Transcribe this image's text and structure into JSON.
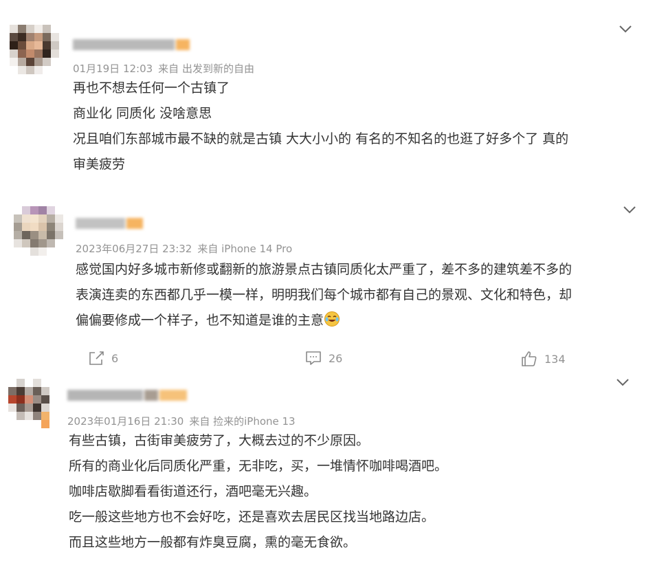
{
  "comments": [
    {
      "meta": {
        "time": "01月19日 12:03",
        "source": "来自 出发到新的自由"
      },
      "lines": [
        "再也不想去任何一个古镇了",
        "商业化 同质化 没啥意思",
        "况且咱们东部城市最不缺的就是古镇 大大小小的 有名的不知名的也逛了好多个了 真的",
        "审美疲劳"
      ]
    },
    {
      "meta": {
        "time": "2023年06月27日 23:32",
        "source": "来自 iPhone 14 Pro"
      },
      "lines": [
        "感觉国内好多城市新修或翻新的旅游景点古镇同质化太严重了，差不多的建筑差不多的",
        "表演连卖的东西都几乎一模一样，明明我们每个城市都有自己的景观、文化和特色，却",
        "偏偏要修成一个样子，也不知道是谁的主意"
      ],
      "actions": {
        "share": "6",
        "comment": "26",
        "like": "134"
      },
      "emoji": "laughing-crying-emoji"
    },
    {
      "meta": {
        "time": "2023年01月16日 21:30",
        "source": "来自 捡来的iPhone 13"
      },
      "lines": [
        "有些古镇，古街审美疲劳了，大概去过的不少原因。",
        "所有的商业化后同质化严重，无非吃，买，一堆情怀咖啡喝酒吧。",
        "咖啡店歇脚看看街道还行，酒吧毫无兴趣。",
        "吃一般这些地方也不会好吃，还是喜欢去居民区找当地路边店。",
        "而且这些地方一般都有炸臭豆腐，熏的毫无食欲。"
      ]
    }
  ],
  "colors": {
    "text": "#333333",
    "meta": "#939393",
    "icon": "#888888",
    "emoji": "#f5c542"
  }
}
